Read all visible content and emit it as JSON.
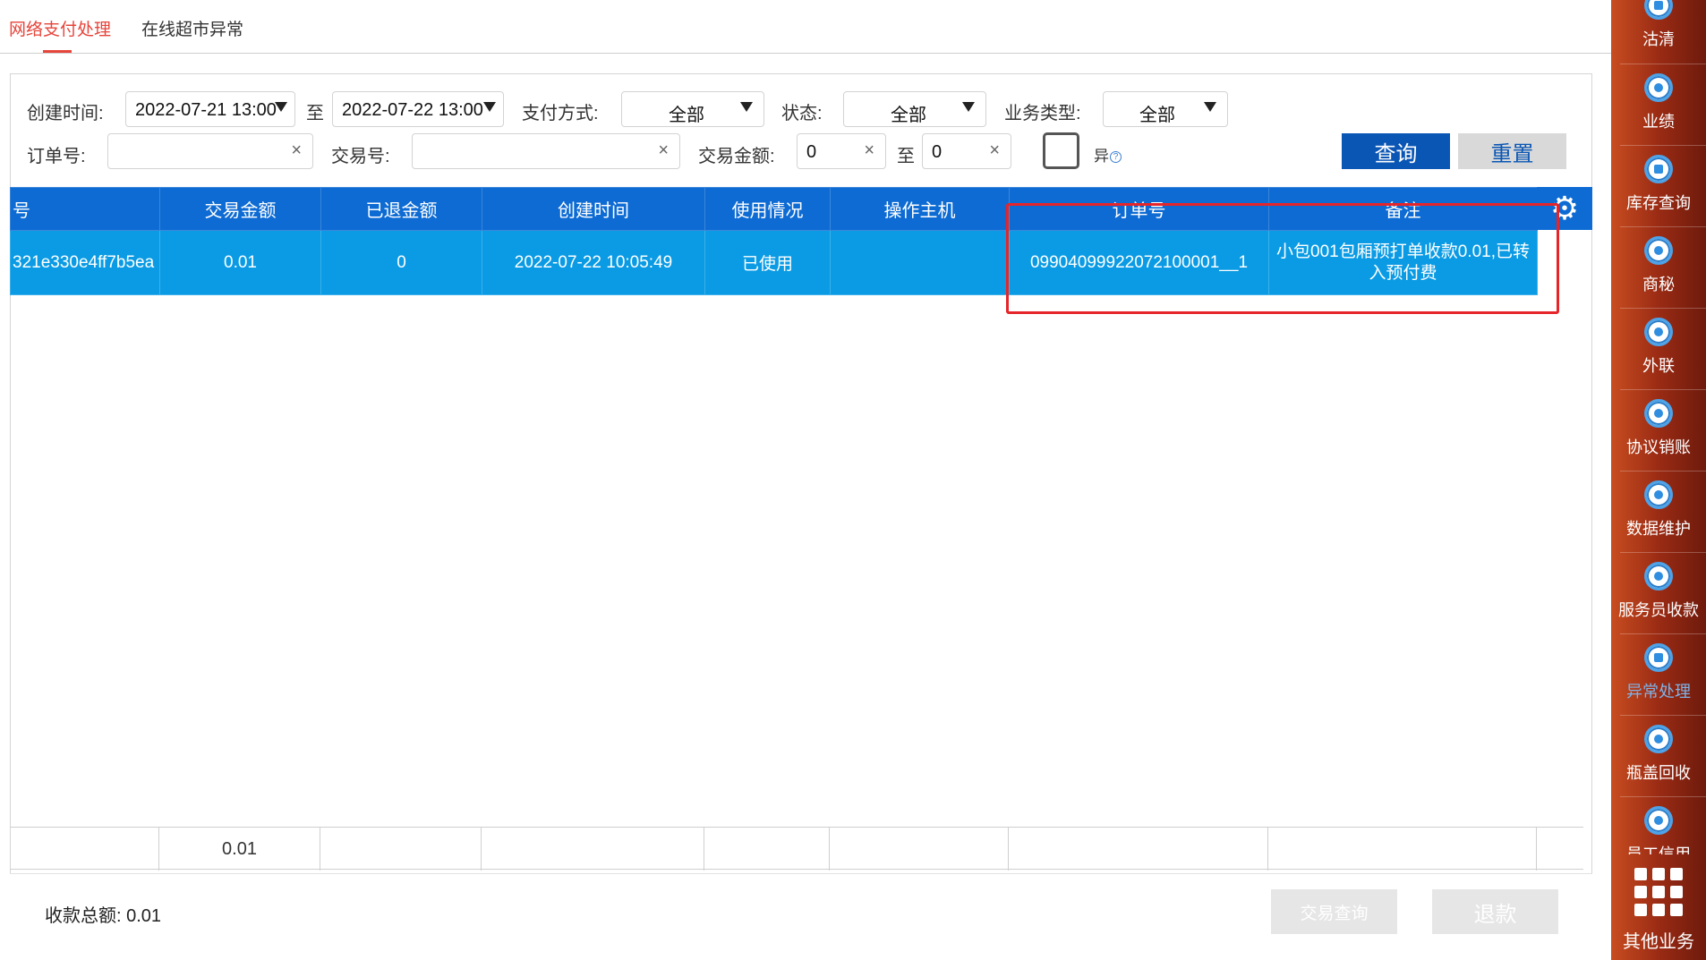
{
  "tabs": [
    {
      "label": "网络支付处理",
      "active": true
    },
    {
      "label": "在线超市异常",
      "active": false
    }
  ],
  "filters": {
    "created_label": "创建时间:",
    "created_from": "2022-07-21 13:00",
    "to_label": "至",
    "created_to": "2022-07-22 13:00",
    "pay_method_label": "支付方式:",
    "pay_method_value": "全部",
    "status_label": "状态:",
    "status_value": "全部",
    "biz_type_label": "业务类型:",
    "biz_type_value": "全部",
    "order_no_label": "订单号:",
    "order_no_value": "",
    "trade_no_label": "交易号:",
    "trade_no_value": "",
    "amount_label": "交易金额:",
    "amount_from": "0",
    "amount_to": "0",
    "abnormal_label": "异",
    "query_label": "查询",
    "reset_label": "重置",
    "clear_glyph": "×"
  },
  "table": {
    "columns": [
      "号",
      "交易金额",
      "已退金额",
      "创建时间",
      "使用情况",
      "操作主机",
      "订单号",
      "备注"
    ],
    "rows": [
      {
        "trade_no_cut": "321e330e4ff7b5ea",
        "amount": "0.01",
        "refunded": "0",
        "created": "2022-07-22 10:05:49",
        "usage": "已使用",
        "host": "",
        "order_no": "09904099922072100001__1",
        "remark": "小包001包厢预打单收款0.01,已转入预付费"
      }
    ],
    "totals": {
      "amount": "0.01"
    }
  },
  "footer": {
    "sum_label": "收款总额:",
    "sum_value": "0.01",
    "trade_query_label": "交易查询",
    "refund_label": "退款"
  },
  "sidenav": {
    "items": [
      {
        "label": "沽清",
        "icon": "list-icon"
      },
      {
        "label": "业绩",
        "icon": "pie-chart-icon"
      },
      {
        "label": "库存查询",
        "icon": "grid-icon"
      },
      {
        "label": "商秘",
        "icon": "download-icon"
      },
      {
        "label": "外联",
        "icon": "users-icon"
      },
      {
        "label": "协议销账",
        "icon": "download-icon"
      },
      {
        "label": "数据维护",
        "icon": "pie-chart-icon"
      },
      {
        "label": "服务员收款",
        "icon": "person-icon"
      },
      {
        "label": "异常处理",
        "icon": "table-icon",
        "active": true
      },
      {
        "label": "瓶盖回收",
        "icon": "bag-icon"
      },
      {
        "label": "员工信用",
        "icon": "badge-icon"
      }
    ],
    "more_label": "其他业务"
  },
  "colors": {
    "header_blue": "#0d6bd3",
    "row_blue": "#0a9be4",
    "query_blue": "#0a56b4",
    "highlight_red": "#e5252a",
    "tab_active_red": "#e6453b"
  }
}
